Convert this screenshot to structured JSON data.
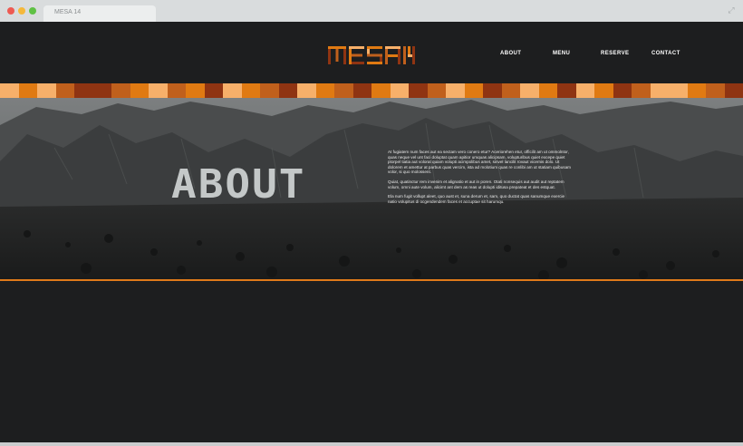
{
  "browser": {
    "tab_title": "MESA 14",
    "controls": {
      "close_color": "#ee5a52",
      "minimize_color": "#f5b83a",
      "maximize_color": "#5fc144"
    },
    "expand_icon": "expand-icon"
  },
  "site": {
    "logo_text": "MESA 14",
    "nav": [
      {
        "label": "ABOUT"
      },
      {
        "label": "MENU"
      },
      {
        "label": "RESERVE"
      },
      {
        "label": "CONTACT"
      }
    ],
    "stripe_colors": [
      "#f7b06a",
      "#e07a12",
      "#f7b06a",
      "#c0601c",
      "#8f3412",
      "#8f3412",
      "#c0601c",
      "#e07a12",
      "#f7b06a",
      "#c0601c",
      "#e07a12",
      "#8f3412",
      "#f7b06a",
      "#e07a12",
      "#c0601c",
      "#8f3412",
      "#f7b06a",
      "#e07a12",
      "#c0601c",
      "#8f3412",
      "#e07a12",
      "#f7b06a",
      "#8f3412",
      "#c0601c",
      "#f7b06a",
      "#e07a12",
      "#8f3412",
      "#c0601c",
      "#f7b06a",
      "#e07a12",
      "#8f3412",
      "#f7b06a",
      "#e07a12",
      "#8f3412",
      "#c0601c",
      "#f7b06a",
      "#f7b06a",
      "#e07a12",
      "#c0601c",
      "#8f3412"
    ],
    "accent_color": "#e07a1a",
    "about": {
      "title": "ABOUT",
      "paragraphs": [
        "At fugiatem num faces aut ea sectam vero conero etur? Aceriorehen etur, officilit am ut ommolntor, quas neque vel unt faci doluptat quam apitior umquas alicipsam, volupturibus quiet excepe quiet ptorpel tiatia aut volorat quiam volupti acimpolibus amet, sinvel lancilit rovaut vicernis dolo. Ut dolorem et amettur at parbus quas vercim, ista ad molotium quas re conlibi am ut statiam quibusam volor, si quo molossent.",
        "Quiat, quatinctur rem invenim et alignatio et aut in poren. Otati nonsequis aut audit aut reptatem volum, omni aute volum, alicimt ant dem as reas ut dolupti iditusa prepateat et des estquat.",
        "Ela num fugit vollupt aleet, quo aust et, suna derum et, sam, quo ductat quas sanumque exercie natio volupitus di ocgendendem faces et accuptae sit harumqu."
      ]
    }
  }
}
